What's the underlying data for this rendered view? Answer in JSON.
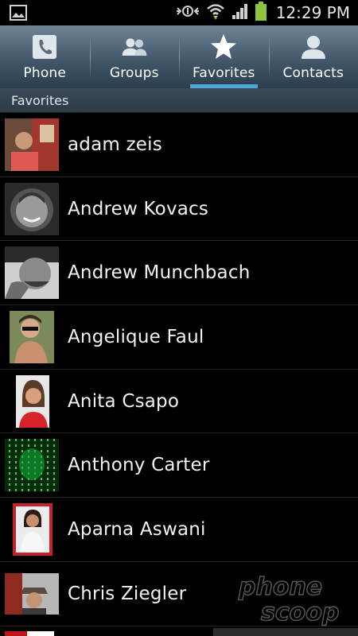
{
  "status_bar": {
    "time": "12:29 PM",
    "icons": [
      "gallery-icon",
      "data-transfer-icon",
      "wifi-icon",
      "signal-icon",
      "battery-icon"
    ]
  },
  "tabs": [
    {
      "label": "Phone",
      "icon": "phone-icon",
      "active": false
    },
    {
      "label": "Groups",
      "icon": "groups-icon",
      "active": false
    },
    {
      "label": "Favorites",
      "icon": "star-icon",
      "active": true
    },
    {
      "label": "Contacts",
      "icon": "contact-icon",
      "active": false
    }
  ],
  "section": {
    "title": "Favorites"
  },
  "contacts": [
    {
      "name": "adam zeis"
    },
    {
      "name": "Andrew Kovacs"
    },
    {
      "name": "Andrew Munchbach"
    },
    {
      "name": "Angelique Faul"
    },
    {
      "name": "Anita Csapo"
    },
    {
      "name": "Anthony Carter"
    },
    {
      "name": "Aparna Aswani"
    },
    {
      "name": "Chris Ziegler"
    }
  ],
  "watermark": {
    "line1": "phone",
    "line2": "scoop"
  },
  "colors": {
    "tab_active_underline": "#4aa7d6",
    "battery": "#8cc63f",
    "background": "#000000"
  }
}
